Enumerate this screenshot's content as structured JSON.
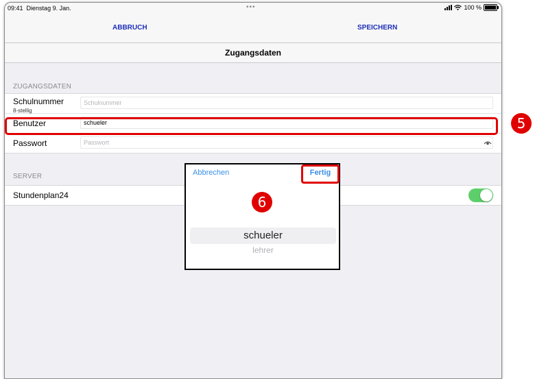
{
  "status_bar": {
    "time": "09:41",
    "date": "Dienstag 9. Jan.",
    "dots": "•••",
    "wifi_icon": "wifi-icon",
    "battery_percent": "100 %"
  },
  "nav": {
    "cancel_label": "ABBRUCH",
    "save_label": "SPEICHERN",
    "title": "Zugangsdaten"
  },
  "credentials": {
    "header": "ZUGANGSDATEN",
    "school_number": {
      "label": "Schulnummer",
      "sublabel": "8-stellig",
      "value": "",
      "placeholder": "Schulnummer"
    },
    "user": {
      "label": "Benutzer",
      "value": "schueler"
    },
    "password": {
      "label": "Passwort",
      "value": "",
      "placeholder": "Passwort",
      "icon": "eye-icon"
    }
  },
  "server": {
    "header": "SERVER",
    "name": "Stundenplan24",
    "enabled": true
  },
  "picker": {
    "cancel_label": "Abbrechen",
    "done_label": "Fertig",
    "options": [
      "schueler",
      "lehrer"
    ],
    "selected": "schueler"
  },
  "annotations": {
    "step_user_field": "5",
    "step_picker": "6",
    "color": "#e00000"
  },
  "colors": {
    "nav_accent": "#1e2fb8",
    "picker_accent": "#3a8ee6",
    "toggle_on": "#5ccf6a"
  }
}
